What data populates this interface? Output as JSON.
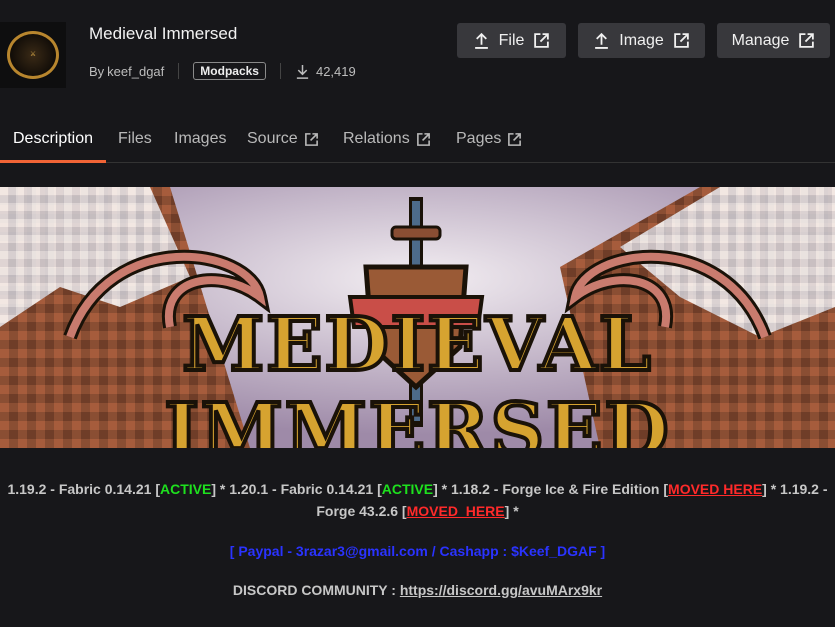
{
  "project": {
    "title": "Medieval Immersed",
    "by_prefix": "By",
    "author": "keef_dgaf",
    "category": "Modpacks",
    "downloads": "42,419"
  },
  "actions": {
    "file": "File",
    "image": "Image",
    "manage": "Manage"
  },
  "tabs": [
    {
      "label": "Description"
    },
    {
      "label": "Files"
    },
    {
      "label": "Images"
    },
    {
      "label": "Source"
    },
    {
      "label": "Relations"
    },
    {
      "label": "Pages"
    }
  ],
  "banner": {
    "text": "MEDIEVAL IMMERSED"
  },
  "info": {
    "l1_a": "1.19.2 - Fabric 0.14.21 [",
    "l1_active1": "ACTIVE",
    "l1_b": "] * 1.20.1 - Fabric 0.14.21 [",
    "l1_active2": "ACTIVE",
    "l1_c": "]  *  1.18.2 - Forge Ice & Fire Edition [",
    "l1_moved1": "MOVED HERE",
    "l1_d": "]  *  1.19.2 - Forge 43.2.6 [",
    "l1_moved2": "MOVED_HERE",
    "l1_e": "]  *",
    "payment": "[ Paypal - 3razar3@gmail.com / Cashapp : $Keef_DGAF ]",
    "discord_label": "DISCORD COMMUNITY : ",
    "discord_link": "https://discord.gg/avuMArx9kr"
  },
  "colors": {
    "accent": "#f16436",
    "active": "#1ee01e",
    "moved": "#ff2a2a",
    "payment": "#2a33ff"
  }
}
